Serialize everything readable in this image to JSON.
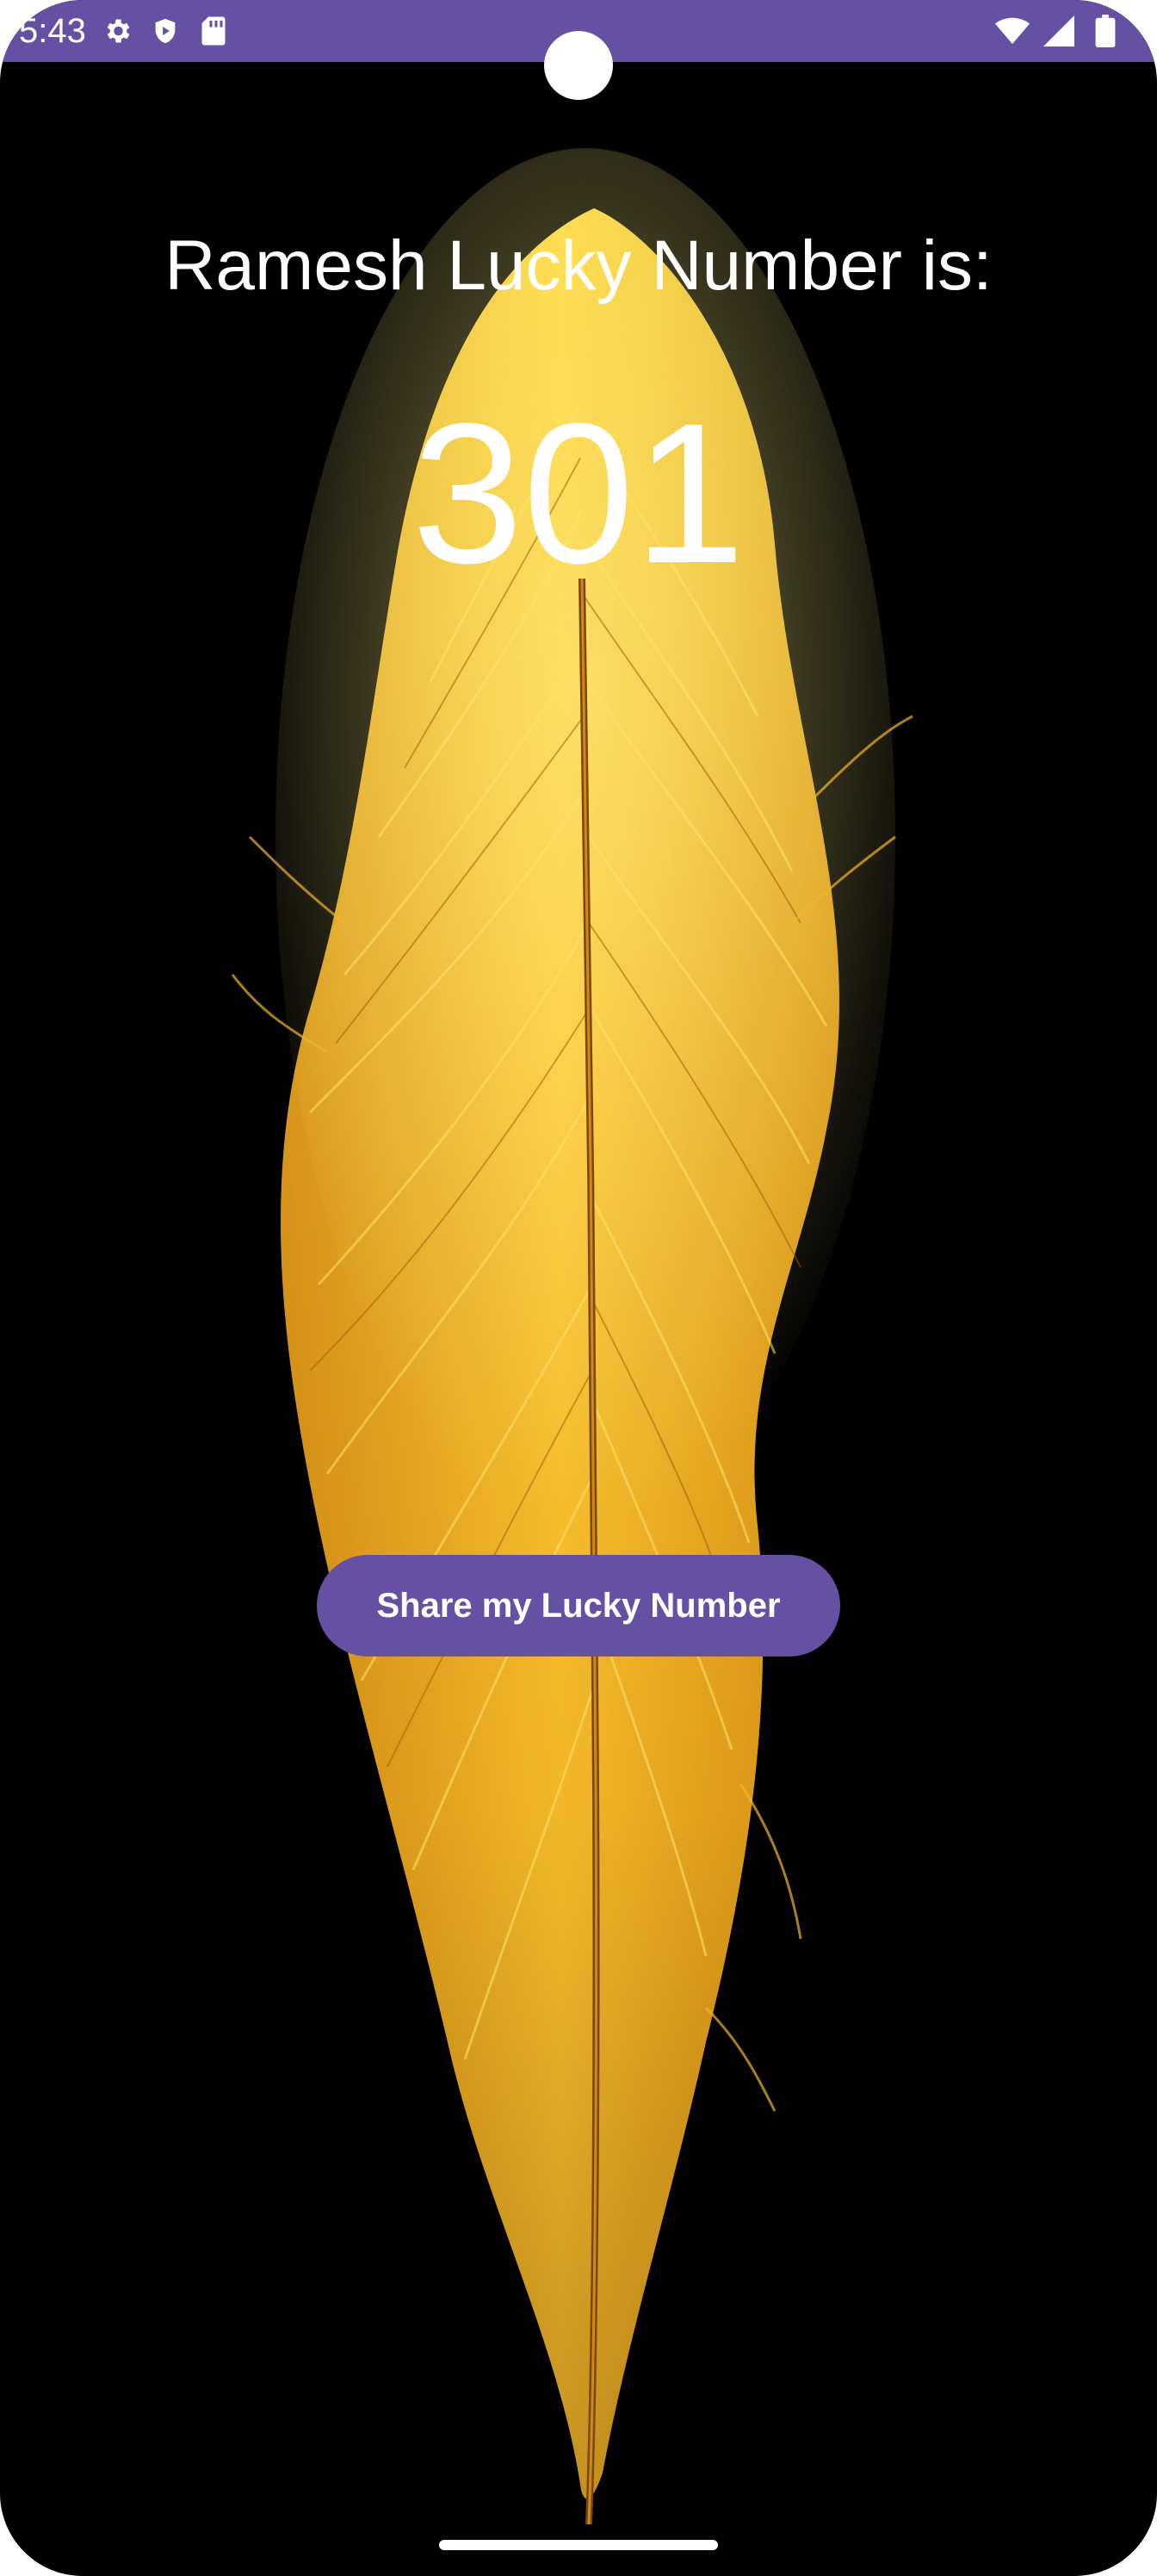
{
  "status_bar": {
    "time": "5:43",
    "left_icons": [
      "gear-icon",
      "shield-play-icon",
      "sd-card-icon"
    ],
    "right_icons": [
      "wifi-icon",
      "signal-icon",
      "battery-icon"
    ],
    "background_color": "#6650A4"
  },
  "main": {
    "title": "Ramesh Lucky Number is:",
    "lucky_number": "301",
    "share_button_label": "Share my Lucky Number",
    "background_image": "golden-feather",
    "accent_color": "#6650A4"
  }
}
